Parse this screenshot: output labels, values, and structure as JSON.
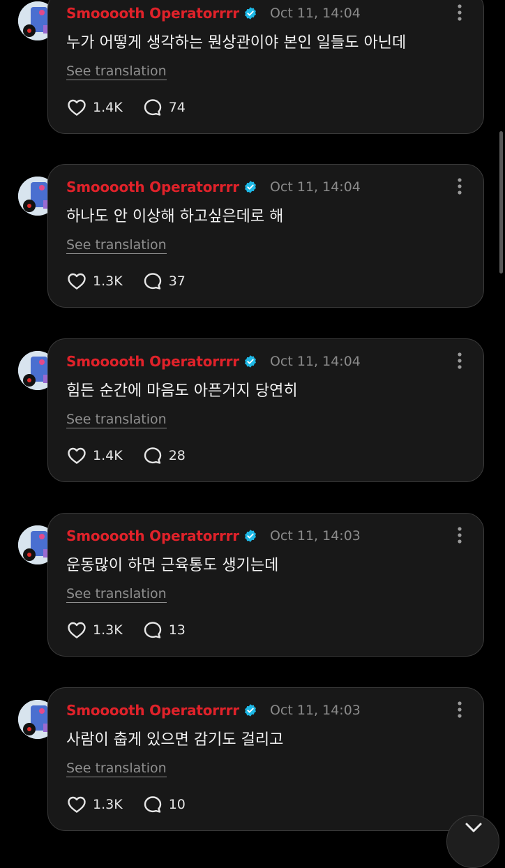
{
  "comments": [
    {
      "author": "Smooooth Operatorrrr",
      "time": "Oct 11, 14:04",
      "text": "누가 어떻게 생각하는 뭔상관이야 본인 일들도 아닌데",
      "translate": "See translation",
      "likes": "1.4K",
      "replies": "74"
    },
    {
      "author": "Smooooth Operatorrrr",
      "time": "Oct 11, 14:04",
      "text": "하나도 안 이상해 하고싶은데로 해",
      "translate": "See translation",
      "likes": "1.3K",
      "replies": "37"
    },
    {
      "author": "Smooooth Operatorrrr",
      "time": "Oct 11, 14:04",
      "text": "힘든 순간에 마음도 아픈거지 당연히",
      "translate": "See translation",
      "likes": "1.4K",
      "replies": "28"
    },
    {
      "author": "Smooooth Operatorrrr",
      "time": "Oct 11, 14:03",
      "text": "운동많이 하면 근육통도 생기는데",
      "translate": "See translation",
      "likes": "1.3K",
      "replies": "13"
    },
    {
      "author": "Smooooth Operatorrrr",
      "time": "Oct 11, 14:03",
      "text": "사람이 춥게 있으면 감기도 걸리고",
      "translate": "See translation",
      "likes": "1.3K",
      "replies": "10"
    }
  ],
  "colors": {
    "author": "#e0222a",
    "verified": "#1db8e6",
    "background": "#000000",
    "card": "#181818"
  },
  "icons": {
    "like": "heart-icon",
    "reply": "speech-bubble-icon",
    "more": "more-vertical-icon",
    "verified": "verified-badge-icon",
    "scroll": "chevron-down-icon"
  }
}
